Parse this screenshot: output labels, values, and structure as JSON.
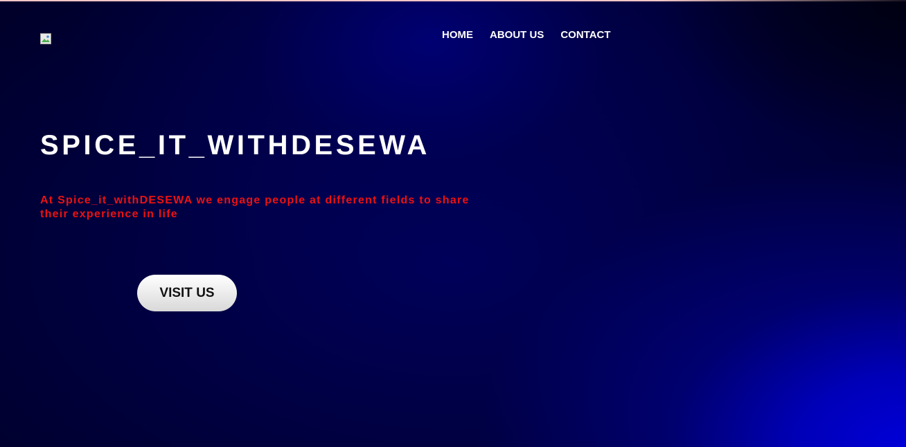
{
  "header": {
    "logo_icon": "broken-image-icon",
    "nav": [
      {
        "label": "HOME"
      },
      {
        "label": "ABOUT US"
      },
      {
        "label": "CONTACT"
      }
    ]
  },
  "hero": {
    "title": "SPICE_IT_WITHDESEWA",
    "description": "At Spice_it_withDESEWA we engage people at different fields to share their experience in life",
    "button_label": "VISIT US"
  },
  "colors": {
    "background": "#000040",
    "accent_blue": "#0000d8",
    "title_text": "#ffffff",
    "description_text": "#ee1111",
    "button_bg": "#eeeeee",
    "top_border": "#f3c6c6"
  }
}
